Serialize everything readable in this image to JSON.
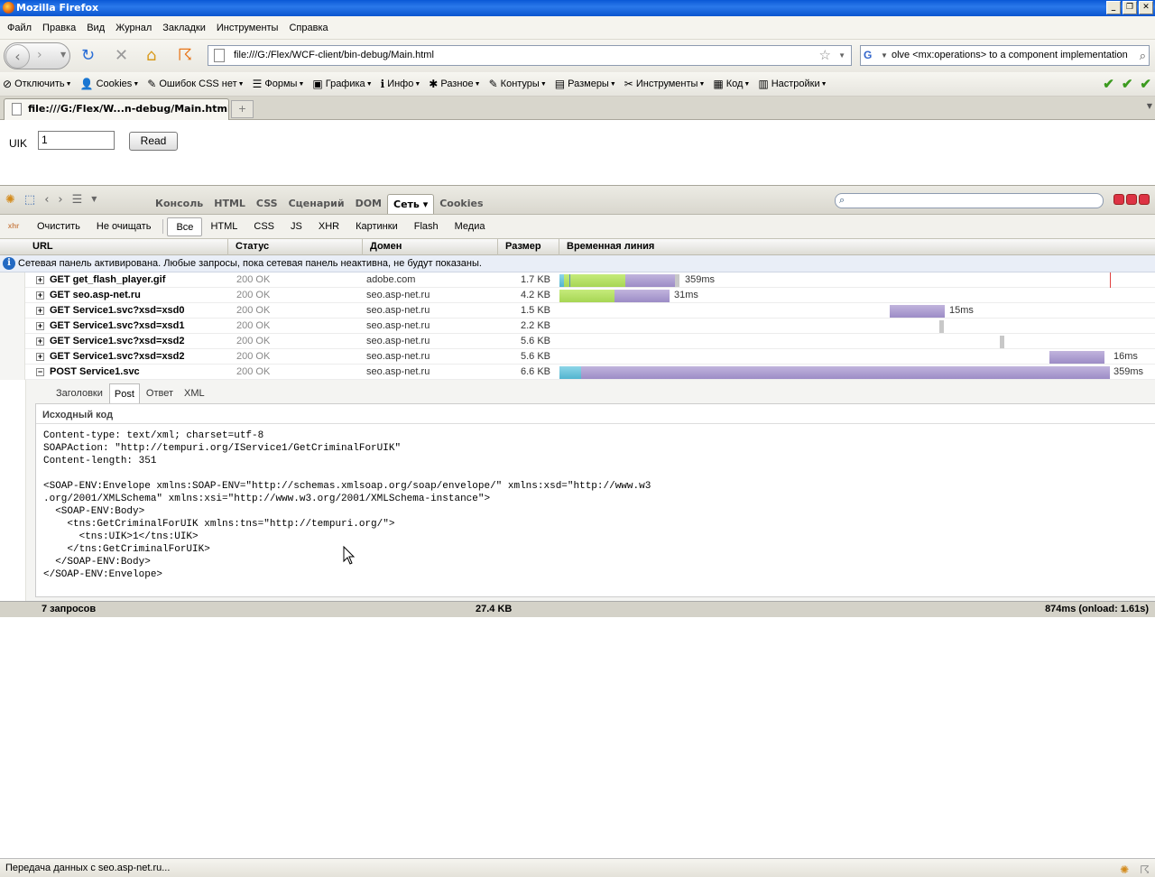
{
  "window": {
    "title": "Mozilla Firefox"
  },
  "menu": [
    "Файл",
    "Правка",
    "Вид",
    "Журнал",
    "Закладки",
    "Инструменты",
    "Справка"
  ],
  "nav": {
    "url": "file:///G:/Flex/WCF-client/bin-debug/Main.html",
    "search": "olve <mx:operations> to a component implementation"
  },
  "devtoolbar": {
    "items": [
      {
        "label": "Отключить",
        "icon": "⊘"
      },
      {
        "label": "Cookies",
        "icon": "👤"
      },
      {
        "label": "Ошибок CSS нет",
        "icon": "✎"
      },
      {
        "label": "Формы",
        "icon": "☰"
      },
      {
        "label": "Графика",
        "icon": "▣"
      },
      {
        "label": "Инфо",
        "icon": "ℹ"
      },
      {
        "label": "Разное",
        "icon": "✱"
      },
      {
        "label": "Контуры",
        "icon": "✎"
      },
      {
        "label": "Размеры",
        "icon": "▤"
      },
      {
        "label": "Инструменты",
        "icon": "✂"
      },
      {
        "label": "Код",
        "icon": "▦"
      },
      {
        "label": "Настройки",
        "icon": "▥"
      }
    ]
  },
  "tab": {
    "title": "file:///G:/Flex/W...n-debug/Main.html"
  },
  "page": {
    "uik_label": "UIK",
    "uik_value": "1",
    "read_button": "Read"
  },
  "firebug": {
    "tabs": [
      "Консоль",
      "HTML",
      "CSS",
      "Сценарий",
      "DOM",
      "Сеть ▾",
      "Cookies"
    ],
    "active_tab": 5
  },
  "netfilter": {
    "clear": "Очистить",
    "persist": "Не очищать",
    "filters": [
      "Все",
      "HTML",
      "CSS",
      "JS",
      "XHR",
      "Картинки",
      "Flash",
      "Медиа"
    ]
  },
  "netheader": {
    "url": "URL",
    "status": "Статус",
    "domain": "Домен",
    "size": "Размер",
    "timeline": "Временная линия"
  },
  "netinfo": "Сетевая панель активирована. Любые запросы, пока сетевая панель неактивна, не будут показаны.",
  "requests": [
    {
      "url": "GET get_flash_player.gif",
      "status": "200 OK",
      "domain": "adobe.com",
      "size": "1.7 KB",
      "time": "359ms",
      "toggle": "+"
    },
    {
      "url": "GET seo.asp-net.ru",
      "status": "200 OK",
      "domain": "seo.asp-net.ru",
      "size": "4.2 KB",
      "time": "31ms",
      "toggle": "+"
    },
    {
      "url": "GET Service1.svc?xsd=xsd0",
      "status": "200 OK",
      "domain": "seo.asp-net.ru",
      "size": "1.5 KB",
      "time": "15ms",
      "toggle": "+"
    },
    {
      "url": "GET Service1.svc?xsd=xsd1",
      "status": "200 OK",
      "domain": "seo.asp-net.ru",
      "size": "2.2 KB",
      "time": "",
      "toggle": "+"
    },
    {
      "url": "GET Service1.svc?xsd=xsd2",
      "status": "200 OK",
      "domain": "seo.asp-net.ru",
      "size": "5.6 KB",
      "time": "",
      "toggle": "+"
    },
    {
      "url": "GET Service1.svc?xsd=xsd2",
      "status": "200 OK",
      "domain": "seo.asp-net.ru",
      "size": "5.6 KB",
      "time": "16ms",
      "toggle": "+"
    },
    {
      "url": "POST Service1.svc",
      "status": "200 OK",
      "domain": "seo.asp-net.ru",
      "size": "6.6 KB",
      "time": "359ms",
      "toggle": "−"
    }
  ],
  "details": {
    "tabs": [
      "Заголовки",
      "Post",
      "Ответ",
      "XML"
    ],
    "active_tab": 1,
    "source_heading": "Исходный код",
    "source": "Content-type: text/xml; charset=utf-8\nSOAPAction: \"http://tempuri.org/IService1/GetCriminalForUIK\"\nContent-length: 351\n\n<SOAP-ENV:Envelope xmlns:SOAP-ENV=\"http://schemas.xmlsoap.org/soap/envelope/\" xmlns:xsd=\"http://www.w3\n.org/2001/XMLSchema\" xmlns:xsi=\"http://www.w3.org/2001/XMLSchema-instance\">\n  <SOAP-ENV:Body>\n    <tns:GetCriminalForUIK xmlns:tns=\"http://tempuri.org/\">\n      <tns:UIK>1</tns:UIK>\n    </tns:GetCriminalForUIK>\n  </SOAP-ENV:Body>\n</SOAP-ENV:Envelope>"
  },
  "netfooter": {
    "count": "7 запросов",
    "size": "27.4 KB",
    "time": "874ms (onload: 1.61s)"
  },
  "statusbar": {
    "text": "Передача данных с seo.asp-net.ru..."
  }
}
